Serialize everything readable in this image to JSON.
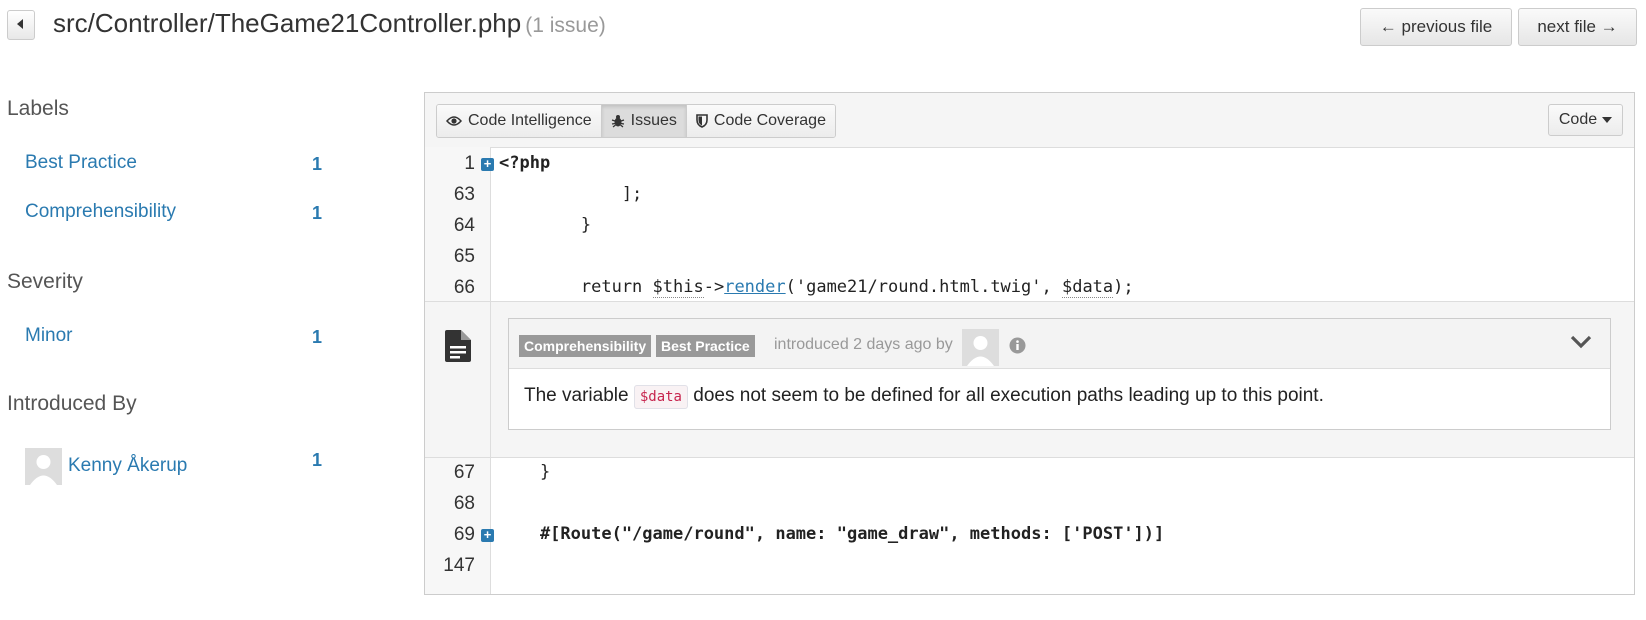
{
  "header": {
    "back_icon": "caret-left-icon",
    "file_path": "src/Controller/TheGame21Controller.php",
    "issue_count": "(1 issue)",
    "prev_label": "← previous file",
    "next_label": "next file →"
  },
  "sidebar": {
    "labels_heading": "Labels",
    "labels": [
      {
        "name": "Best Practice",
        "count": "1"
      },
      {
        "name": "Comprehensibility",
        "count": "1"
      }
    ],
    "severity_heading": "Severity",
    "severities": [
      {
        "name": "Minor",
        "count": "1"
      }
    ],
    "introduced_heading": "Introduced By",
    "authors": [
      {
        "name": "Kenny Åkerup",
        "count": "1"
      }
    ]
  },
  "toolbar": {
    "tabs": [
      {
        "label": "Code Intelligence",
        "icon": "eye-icon"
      },
      {
        "label": "Issues",
        "icon": "bug-icon"
      },
      {
        "label": "Code Coverage",
        "icon": "shield-icon"
      }
    ],
    "code_dropdown": "Code"
  },
  "code_lines": {
    "l1": {
      "num": "1",
      "text": "<?php"
    },
    "l63": {
      "num": "63",
      "text": "            ];"
    },
    "l64": {
      "num": "64",
      "text": "        }"
    },
    "l65": {
      "num": "65",
      "text": ""
    },
    "l66": {
      "num": "66",
      "pre": "        return ",
      "this": "$this",
      "arrow": "->",
      "fn": "render",
      "args": "('game21/round.html.twig', ",
      "var": "$data",
      "end": ");"
    },
    "l67": {
      "num": "67",
      "text": "    }"
    },
    "l68": {
      "num": "68",
      "text": ""
    },
    "l69": {
      "num": "69",
      "text": "    #[Route(\"/game/round\", name: \"game_draw\", methods: ['POST'])]"
    },
    "l147": {
      "num": "147",
      "text": ""
    }
  },
  "issue": {
    "labels": [
      "Comprehensibility",
      "Best Practice"
    ],
    "introduced": "introduced 2 days ago by",
    "message_before": "The variable ",
    "variable": "$data",
    "message_after": " does not seem to be defined for all execution paths leading up to this point."
  },
  "colors": {
    "link": "#2a7ab0",
    "badge": "#999999",
    "code_var": "#c7254e"
  }
}
